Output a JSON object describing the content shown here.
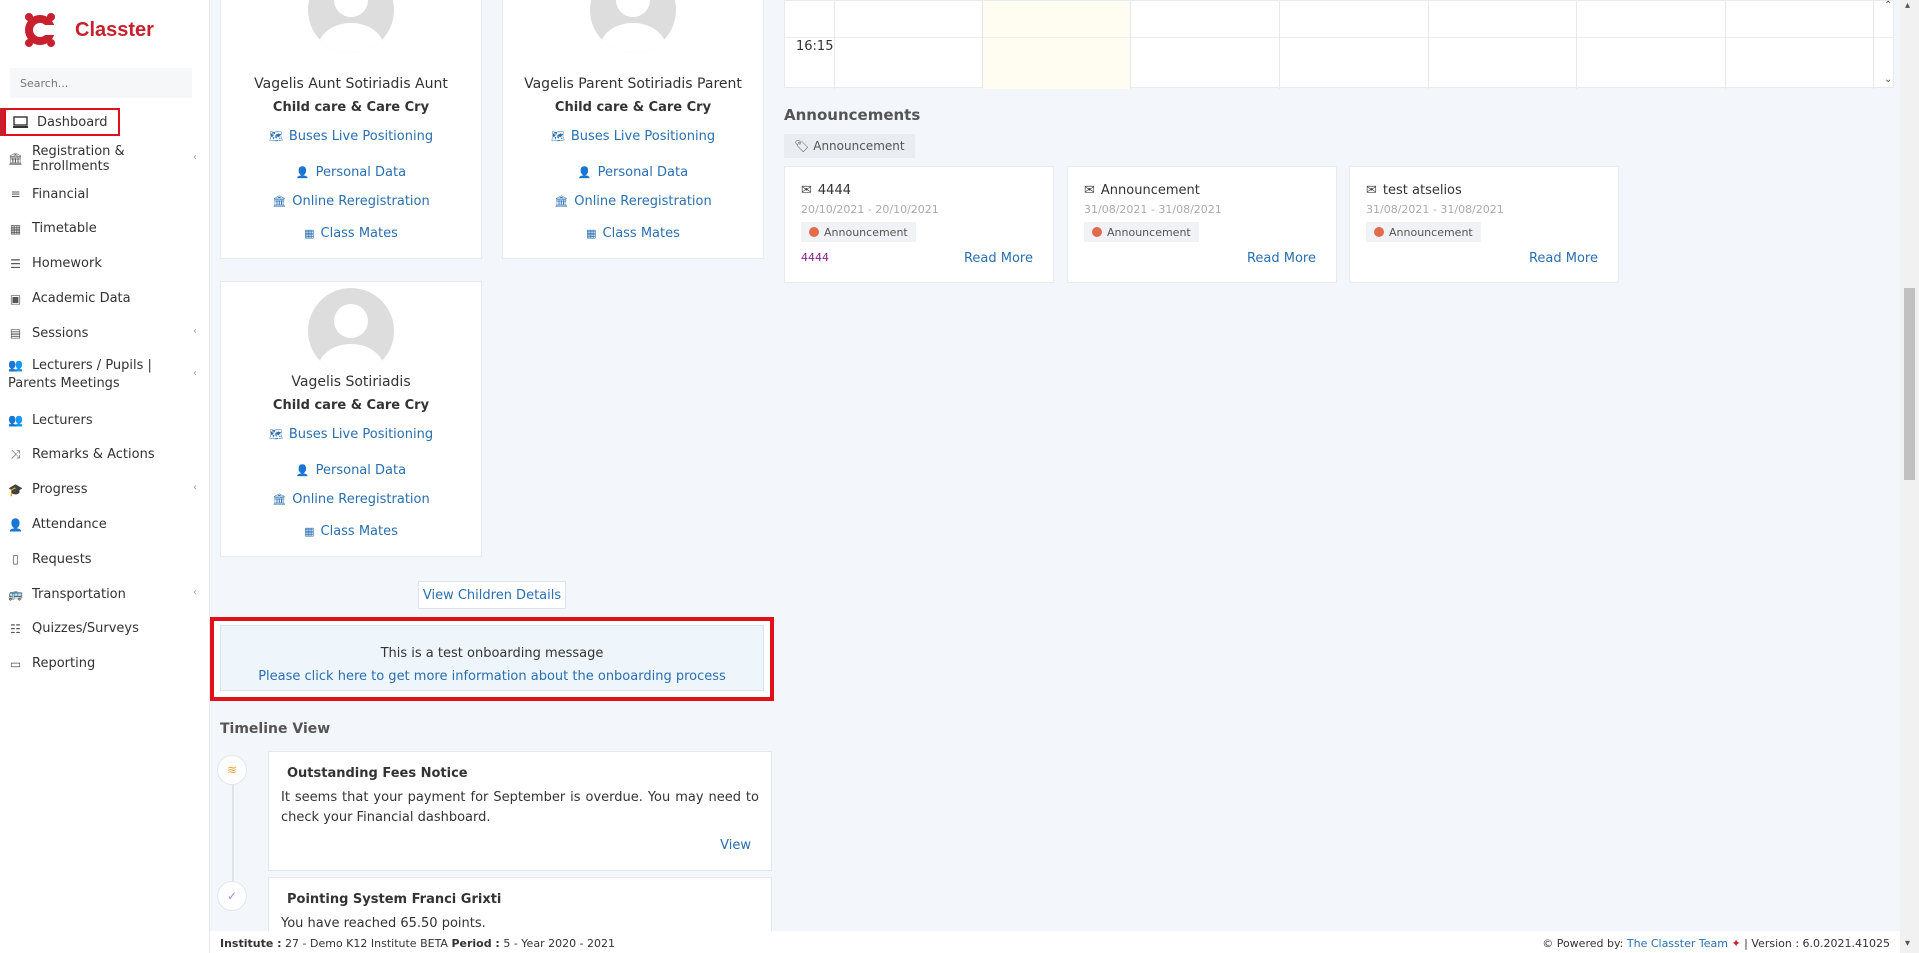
{
  "app": {
    "name": "Classter"
  },
  "search": {
    "placeholder": "Search..."
  },
  "sidebar": {
    "items": [
      {
        "label": "Dashboard"
      },
      {
        "label": "Registration & Enrollments"
      },
      {
        "label": "Financial"
      },
      {
        "label": "Timetable"
      },
      {
        "label": "Homework"
      },
      {
        "label": "Academic Data"
      },
      {
        "label": "Sessions"
      },
      {
        "label": "Lecturers / Pupils | Parents Meetings"
      },
      {
        "label": "Lecturers"
      },
      {
        "label": "Remarks & Actions"
      },
      {
        "label": "Progress"
      },
      {
        "label": "Attendance"
      },
      {
        "label": "Requests"
      },
      {
        "label": "Transportation"
      },
      {
        "label": "Quizzes/Surveys"
      },
      {
        "label": "Reporting"
      }
    ]
  },
  "children": [
    {
      "name": "Vagelis Aunt Sotiriadis Aunt",
      "relation": "Child care & Care Cry",
      "links": [
        "Buses Live Positioning",
        "Personal Data",
        "Online Reregistration",
        "Class Mates"
      ]
    },
    {
      "name": "Vagelis Parent Sotiriadis Parent",
      "relation": "Child care & Care Cry",
      "links": [
        "Buses Live Positioning",
        "Personal Data",
        "Online Reregistration",
        "Class Mates"
      ]
    },
    {
      "name": "Vagelis Sotiriadis",
      "relation": "Child care & Care Cry",
      "links": [
        "Buses Live Positioning",
        "Personal Data",
        "Online Reregistration",
        "Class Mates"
      ]
    }
  ],
  "view_children_label": "View Children Details",
  "onboarding": {
    "line1": "This is a test onboarding message",
    "line2": "Please click here to get more information about the onboarding process"
  },
  "timeline": {
    "title": "Timeline View",
    "items": [
      {
        "title": "Outstanding Fees Notice",
        "text": "It seems that your payment for September is overdue. You may need to check your Financial dashboard.",
        "action": "View"
      },
      {
        "title": "Pointing System Franci Grixti",
        "text": "You have reached 65.50 points."
      }
    ]
  },
  "calendar": {
    "time": "16:15"
  },
  "announcements": {
    "title": "Announcements",
    "filter_tag": "Announcement",
    "items": [
      {
        "title": "4444",
        "dates": "20/10/2021 - 20/10/2021",
        "badge": "Announcement",
        "body": "4444",
        "read_more": "Read More"
      },
      {
        "title": "Announcement",
        "dates": "31/08/2021 - 31/08/2021",
        "badge": "Announcement",
        "body": "",
        "read_more": "Read More"
      },
      {
        "title": "test atselios",
        "dates": "31/08/2021 - 31/08/2021",
        "badge": "Announcement",
        "body": "",
        "read_more": "Read More"
      }
    ]
  },
  "footer": {
    "institute_label": "Institute :",
    "institute_value": " 27 - Demo K12 Institute BETA ",
    "period_label": "Period :",
    "period_value": " 5 - Year 2020 - 2021",
    "powered_label": "Powered by:",
    "powered_value": "The Classter Team",
    "version": "| Version : 6.0.2021.41025"
  }
}
